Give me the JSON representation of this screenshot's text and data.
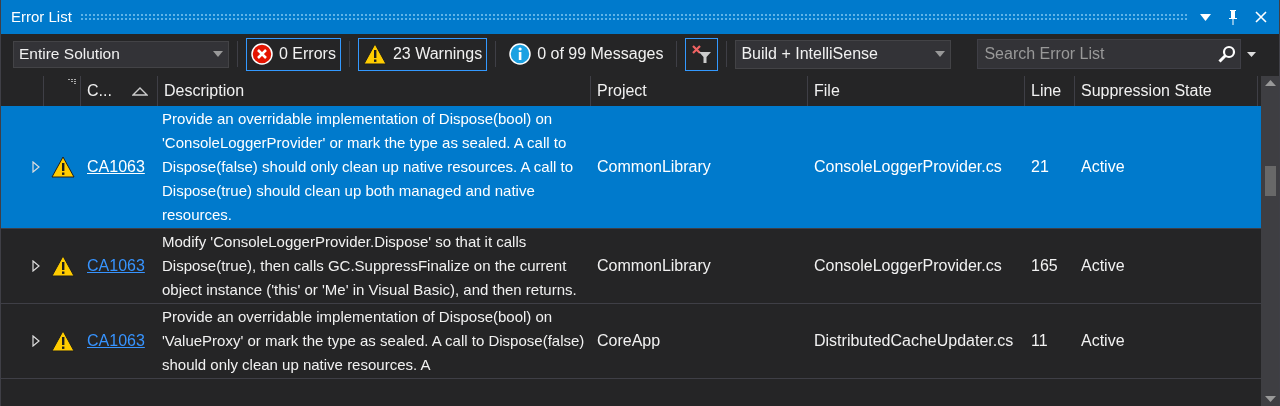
{
  "window": {
    "title": "Error List"
  },
  "toolbar": {
    "scope": "Entire Solution",
    "filters": [
      {
        "kind": "error",
        "label": "0 Errors",
        "selected": true
      },
      {
        "kind": "warning",
        "label": "23 Warnings",
        "selected": true
      },
      {
        "kind": "info",
        "label": "0 of 99 Messages",
        "selected": false
      }
    ],
    "clear_filter_selected": true,
    "source": "Build + IntelliSense",
    "search": {
      "placeholder": "Search Error List"
    }
  },
  "table": {
    "columns": [
      "C...",
      "Description",
      "Project",
      "File",
      "Line",
      "Suppression State"
    ],
    "rows": [
      {
        "selected": true,
        "expanded": false,
        "kind": "warning",
        "code": "CA1063",
        "description": "Provide an overridable implementation of Dispose(bool) on 'ConsoleLoggerProvider' or mark the type as sealed. A call to Dispose(false) should only clean up native resources. A call to Dispose(true) should clean up both managed and native resources.",
        "project": "CommonLibrary",
        "file": "ConsoleLoggerProvider.cs",
        "line": "21",
        "suppression": "Active"
      },
      {
        "selected": false,
        "expanded": false,
        "kind": "warning",
        "code": "CA1063",
        "description": "Modify 'ConsoleLoggerProvider.Dispose' so that it calls Dispose(true), then calls GC.SuppressFinalize on the current object instance ('this' or 'Me' in Visual Basic), and then returns.",
        "project": "CommonLibrary",
        "file": "ConsoleLoggerProvider.cs",
        "line": "165",
        "suppression": "Active"
      },
      {
        "selected": false,
        "expanded": false,
        "kind": "warning",
        "code": "CA1063",
        "description": "Provide an overridable implementation of Dispose(bool) on 'ValueProxy' or mark the type as sealed. A call to Dispose(false) should only clean up native resources. A",
        "project": "CoreApp",
        "file": "DistributedCacheUpdater.cs",
        "line": "11",
        "suppression": "Active"
      }
    ]
  }
}
